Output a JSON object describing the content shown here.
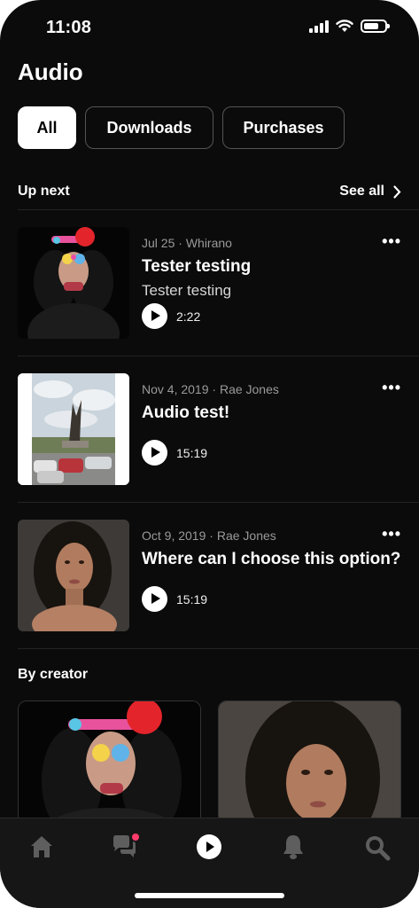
{
  "status_bar": {
    "time": "11:08",
    "icons": [
      "signal-icon",
      "wifi-icon",
      "battery-icon"
    ]
  },
  "page_title": "Audio",
  "tabs": [
    {
      "label": "All",
      "active": true
    },
    {
      "label": "Downloads",
      "active": false
    },
    {
      "label": "Purchases",
      "active": false
    }
  ],
  "up_next": {
    "label": "Up next",
    "see_all": "See all",
    "items": [
      {
        "date": "Jul 25",
        "separator": "·",
        "author": "Whirano",
        "title": "Tester testing",
        "subtitle": "Tester testing",
        "duration": "2:22",
        "more": "•••"
      },
      {
        "date": "Nov 4, 2019",
        "separator": "·",
        "author": "Rae Jones",
        "title": "Audio test!",
        "subtitle": "",
        "duration": "15:19",
        "more": "•••"
      },
      {
        "date": "Oct 9, 2019",
        "separator": "·",
        "author": "Rae Jones",
        "title": "Where can I choose this option?",
        "subtitle": "",
        "duration": "15:19",
        "more": "•••"
      }
    ]
  },
  "by_creator": {
    "label": "By creator"
  },
  "bottom_nav": [
    "home-icon",
    "chat-icon",
    "audio-play-icon",
    "bell-icon",
    "search-icon"
  ],
  "colors": {
    "background": "#0b0b0b",
    "accent": "#ffffff",
    "notification_dot": "#ff3b6b"
  }
}
